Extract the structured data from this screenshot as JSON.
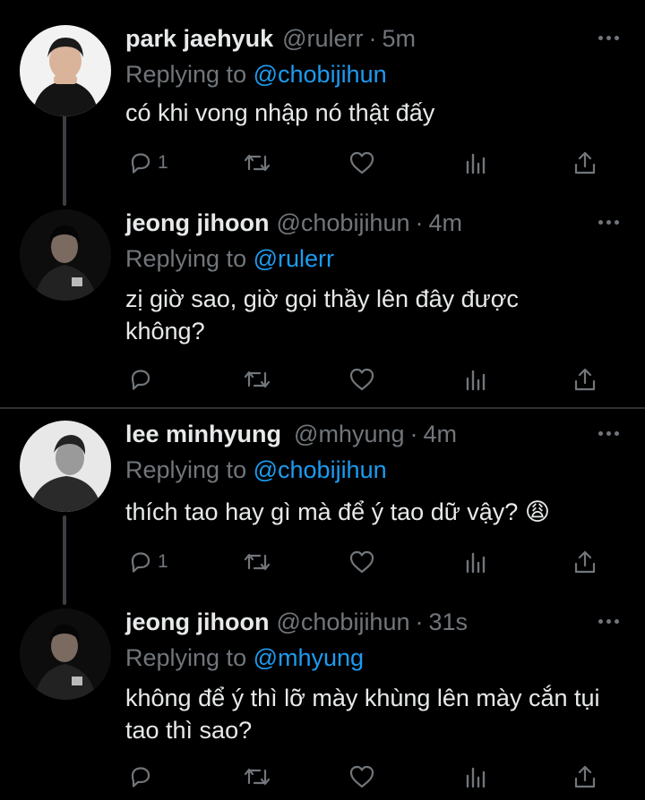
{
  "tweets": [
    {
      "name": "park jaehyuk",
      "handle": "@rulerr",
      "time": "5m",
      "replying_prefix": "Replying to",
      "replying_to": "@chobijihun",
      "text": "có khi vong nhập nó thật đấy",
      "reply_count": "1"
    },
    {
      "name": "jeong jihoon",
      "handle": "@chobijihun",
      "time": "4m",
      "replying_prefix": "Replying to",
      "replying_to": "@rulerr",
      "text": "zị giờ sao, giờ gọi thầy lên đây được không?",
      "reply_count": ""
    },
    {
      "name": "lee minhyung",
      "handle": "@mhyung",
      "time": "4m",
      "replying_prefix": "Replying to",
      "replying_to": "@chobijihun",
      "text": "thích tao hay gì mà để ý tao dữ vậy? 😩",
      "reply_count": "1"
    },
    {
      "name": "jeong jihoon",
      "handle": "@chobijihun",
      "time": "31s",
      "replying_prefix": "Replying to",
      "replying_to": "@mhyung",
      "text": "không để ý thì lỡ mày khùng lên mày cắn tụi tao thì sao?",
      "reply_count": ""
    }
  ],
  "sep": "·",
  "colors": {
    "accent": "#1d9bf0",
    "muted": "#71767b",
    "text": "#e7e9ea",
    "bg": "#000000"
  },
  "icons": [
    "reply-icon",
    "retweet-icon",
    "like-icon",
    "views-icon",
    "share-icon",
    "more-icon"
  ]
}
